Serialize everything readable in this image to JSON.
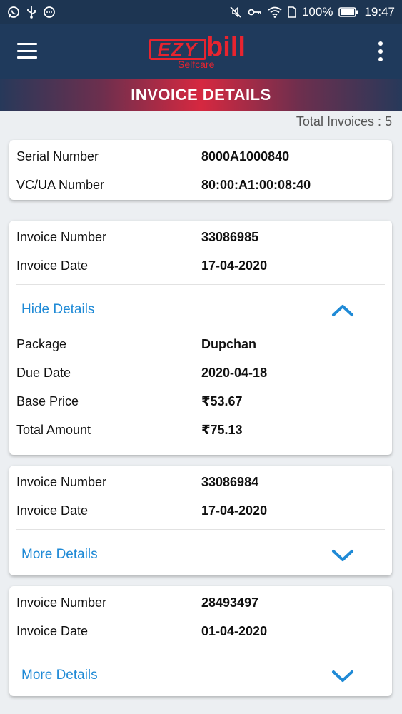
{
  "status_bar": {
    "battery": "100%",
    "time": "19:47"
  },
  "app_bar": {
    "logo_ezy": "EZY",
    "logo_bill": "bill",
    "logo_sub": "Selfcare"
  },
  "page_title": "INVOICE DETAILS",
  "total_invoices": "Total Invoices : 5",
  "device": {
    "serial_label": "Serial Number",
    "serial_value": "8000A1000840",
    "vc_label": "VC/UA Number",
    "vc_value": "80:00:A1:00:08:40"
  },
  "invoices": [
    {
      "number_label": "Invoice Number",
      "number": "33086985",
      "date_label": "Invoice Date",
      "date": "17-04-2020",
      "toggle_label": "Hide Details",
      "expanded": true,
      "details": [
        {
          "label": "Package",
          "value": "Dupchan"
        },
        {
          "label": "Due Date",
          "value": "2020-04-18"
        },
        {
          "label": "Base Price",
          "value": "₹53.67"
        },
        {
          "label": "Total Amount",
          "value": "₹75.13"
        }
      ]
    },
    {
      "number_label": "Invoice Number",
      "number": "33086984",
      "date_label": "Invoice Date",
      "date": "17-04-2020",
      "toggle_label": "More Details",
      "expanded": false
    },
    {
      "number_label": "Invoice Number",
      "number": "28493497",
      "date_label": "Invoice Date",
      "date": "01-04-2020",
      "toggle_label": "More Details",
      "expanded": false
    }
  ],
  "colors": {
    "status_bar": "#1d3552",
    "app_bar": "#1f3a5c",
    "brand_red": "#e8242f",
    "link_blue": "#1f8ad6",
    "background": "#eceff2"
  },
  "icons": {
    "menu": "hamburger-menu-icon",
    "more": "overflow-menu-icon",
    "expand": "chevron-down-icon",
    "collapse": "chevron-up-icon"
  }
}
